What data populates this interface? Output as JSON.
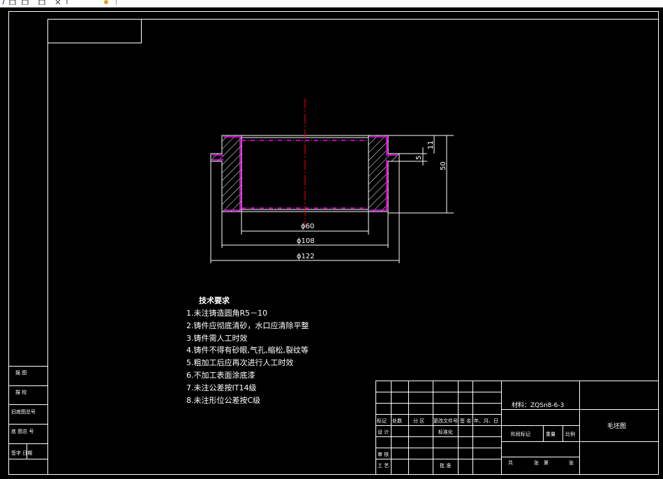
{
  "drawing": {
    "dimensions": {
      "inner_dia": "ϕ60",
      "mid_dia": "ϕ108",
      "outer_dia": "ϕ122",
      "height": "50",
      "flange_offset": "11",
      "flange_thickness": "5"
    },
    "requirements_title": "技术要求",
    "requirements": [
      "1.未注铸造圆角R5－10",
      "2.铸件应彻底清砂，水口应清除平整",
      "3.铸件需人工时效",
      "4.铸件不得有砂眼,气孔,缩松,裂纹等",
      "5.粗加工后应再次进行人工时效",
      "6.不加工表面涂底漆",
      "7.未注公差按IT14级",
      "8.未注形位公差按C级"
    ]
  },
  "left_stamp": [
    "描 图",
    "描 校",
    "旧底图总号",
    "底 图总 号",
    "签字 日期"
  ],
  "title_block": {
    "material": "材料：ZQSn8-6-3",
    "drawing_name": "毛坯图",
    "header_row": [
      "标记",
      "处数",
      "分 区",
      "更改文件号",
      "签 名",
      "年、月、日"
    ],
    "design": "设 计",
    "standardization": "标准化",
    "review": "审 核",
    "process": "工 艺",
    "approve": "批 准",
    "stage_mark": "阶段标记",
    "weight": "重量",
    "scale": "比例",
    "sheets_total": "共",
    "sheets_label": "张",
    "sheet_no": "第",
    "sheet_label": "张"
  },
  "colors": {
    "background": "#000000",
    "line": "#ffffff",
    "centerline": "#ff0000",
    "hidden": "#ff00ff"
  }
}
